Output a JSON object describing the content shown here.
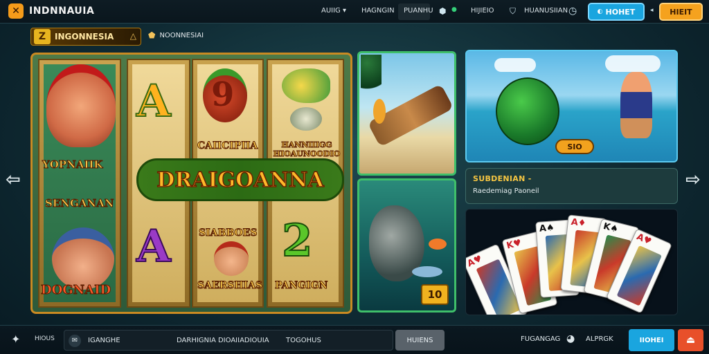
{
  "header": {
    "brand": "INDNNAUIA",
    "nav": [
      "AUIIG",
      "HAGNGIN",
      "PUANHU",
      "HIJIEIO",
      "HUANUSIIAN"
    ],
    "primary_button": "HOHET",
    "secondary_button": "HIEIT",
    "dropdown_glyph": "▾"
  },
  "subheader": {
    "logo_badge": "Z",
    "logo_text": "INGONNESIA",
    "tagline": "NOONNESIAI"
  },
  "slot": {
    "symbols": [
      "A",
      "9",
      "A",
      "2"
    ],
    "captions": [
      "YOPNAIIK",
      "CAIICIPIIA",
      "HANNIIIGG HIOAUNOODIO",
      "SENGANAN",
      "SIABBOES",
      "SAERSHIAS",
      "DOGNAID",
      "PANGIGN"
    ],
    "banner": "DRAIGOANNA"
  },
  "games": {
    "mid_badge": "10",
    "fishing_pill": "SIO",
    "info_title": "SUBDENIAN -",
    "info_sub": "Raedemiag Paoneil"
  },
  "cards": [
    {
      "rank": "A",
      "suit": "♥",
      "color": "#c9202a"
    },
    {
      "rank": "K",
      "suit": "♥",
      "color": "#c9202a"
    },
    {
      "rank": "A",
      "suit": "♠",
      "color": "#111111"
    },
    {
      "rank": "A",
      "suit": "♦",
      "color": "#c9202a"
    },
    {
      "rank": "K",
      "suit": "♠",
      "color": "#111111"
    },
    {
      "rank": "A",
      "suit": "♥",
      "color": "#c9202a"
    }
  ],
  "footer": {
    "home_label": "HIOUS",
    "search_label": "IGANGHE",
    "search_text": "DARHIGNIA DIOAIIADIOUIA",
    "search_tag": "TOGOHUS",
    "action_button": "HUIENS",
    "link1": "FUGANGAG",
    "link2": "ALPRGK",
    "primary_button": "IIOHEI",
    "exit_glyph": "⏏"
  },
  "colors": {
    "accent_blue": "#1aa5df",
    "accent_orange": "#f5a21e",
    "frame_gold": "#c98a22",
    "frame_green": "#3fbf6a"
  }
}
